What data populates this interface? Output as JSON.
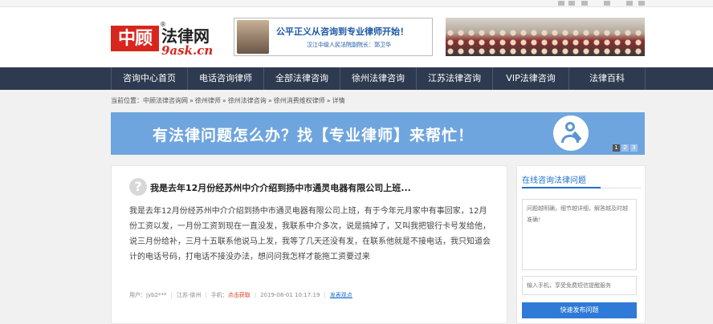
{
  "header": {
    "logo_mark": "中顾",
    "logo_text": "法律网",
    "logo_reg": "®",
    "logo_domain": "9ask.cn",
    "ad_line1": "公平正义从咨询到专业律师开始！",
    "ad_line2": "汉江中级人民法院副院长：郭卫华"
  },
  "nav": {
    "items": [
      "咨询中心首页",
      "电话咨询律师",
      "全部法律咨询",
      "徐州法律咨询",
      "江苏法律咨询",
      "VIP法律咨询",
      "法律百科"
    ]
  },
  "breadcrumb": {
    "prefix": "当前位置：",
    "items": [
      "中顾法律咨询网",
      "徐州律师",
      "徐州法律咨询",
      "徐州消费维权律师",
      "详情"
    ],
    "separator": "»"
  },
  "banner": {
    "text": "有法律问题怎么办？找【专业律师】来帮忙！",
    "dots": [
      "1",
      "2",
      "3"
    ]
  },
  "question": {
    "icon_glyph": "?",
    "title": "我是去年12月份经苏州中介介绍到扬中市通灵电器有限公司上班...",
    "body": "我是去年12月份经苏州中介介绍到扬中市通灵电器有限公司上班，有于今年元月家中有事回家，12月份工资以发，一月份工资到现在一直没发，我联系中介多次，说是搞掉了，又叫我把银行卡号发给他，说三月份给补，三月十五联系他说马上发，我等了几天还没有发，在联系他就是不接电话，我只知道会计的电话号码，打电话不接没办法，想问问我怎样才能拖工资要过来",
    "meta": {
      "user": "用户：jyb2***",
      "location": "江苏-徐州",
      "phone_label": "手机：",
      "phone_value": "点击获取",
      "time": "2019-08-01 10:17:19",
      "action": "发表观点"
    }
  },
  "side": {
    "title": "在线咨询法律问题",
    "textarea_placeholder": "问题越明确，细节越详细，解答越及时越准确！",
    "phone_placeholder": "输入手机，享受免费短信提醒服务",
    "submit_label": "快速发布问题"
  }
}
